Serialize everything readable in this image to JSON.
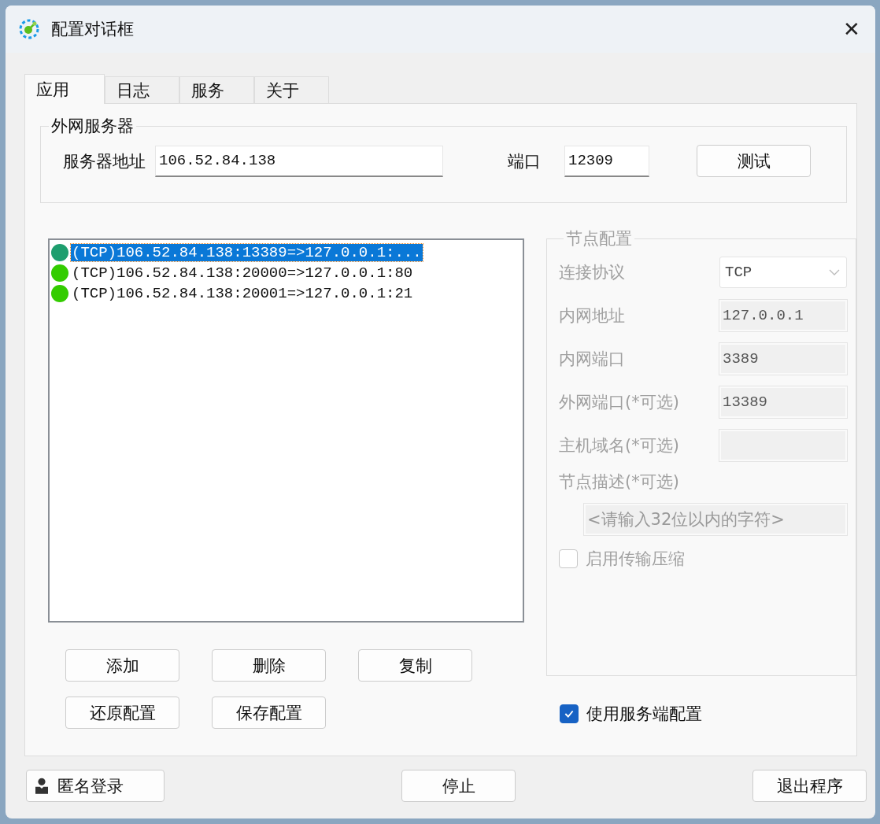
{
  "window": {
    "title": "配置对话框",
    "close": "✕"
  },
  "tabs": [
    {
      "label": "应用",
      "selected": true
    },
    {
      "label": "日志",
      "selected": false
    },
    {
      "label": "服务",
      "selected": false
    },
    {
      "label": "关于",
      "selected": false
    }
  ],
  "server_group": {
    "title": "外网服务器",
    "address_label": "服务器地址",
    "address": "106.52.84.138",
    "port_label": "端口",
    "port": "12309",
    "test_button": "测试"
  },
  "mappings": [
    {
      "text": "(TCP)106.52.84.138:13389=>127.0.0.1:...",
      "selected": true
    },
    {
      "text": "(TCP)106.52.84.138:20000=>127.0.0.1:80",
      "selected": false
    },
    {
      "text": "(TCP)106.52.84.138:20001=>127.0.0.1:21",
      "selected": false
    }
  ],
  "list_buttons": [
    [
      "添加",
      "删除",
      "复制"
    ],
    [
      "还原配置",
      "保存配置"
    ]
  ],
  "node_config": {
    "title": "节点配置",
    "disabled": true,
    "fields": [
      {
        "kind": "select",
        "label": "连接协议",
        "value": "TCP"
      },
      {
        "kind": "input",
        "label": "内网地址",
        "value": "127.0.0.1"
      },
      {
        "kind": "input",
        "label": "内网端口",
        "value": "3389"
      },
      {
        "kind": "input",
        "label": "外网端口(*可选)",
        "value": "13389"
      },
      {
        "kind": "input",
        "label": "主机域名(*可选)"
      }
    ],
    "description_label": "节点描述(*可选)",
    "description_placeholder": "<请输入32位以内的字符>",
    "compression": {
      "label": "启用传输压缩",
      "checked": false
    }
  },
  "use_server_config": {
    "label": "使用服务端配置",
    "checked": true
  },
  "footer": {
    "anonymous_login": "匿名登录",
    "stop": "停止",
    "exit": "退出程序"
  }
}
